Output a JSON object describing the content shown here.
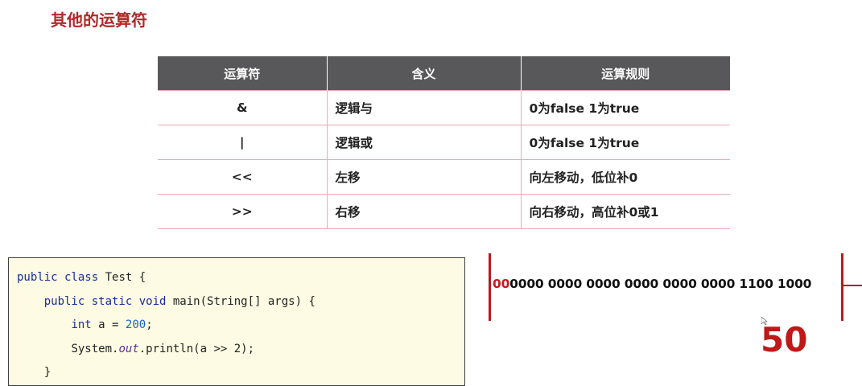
{
  "slide": {
    "title": "其他的运算符"
  },
  "table": {
    "headers": [
      "运算符",
      "含义",
      "运算规则"
    ],
    "rows": [
      {
        "op": "&",
        "meaning": "逻辑与",
        "rule": "0为false 1为true"
      },
      {
        "op": "|",
        "meaning": "逻辑或",
        "rule": "0为false 1为true"
      },
      {
        "op": "<<",
        "meaning": "左移",
        "rule": "向左移动，低位补0"
      },
      {
        "op": ">>",
        "meaning": "右移",
        "rule": "向右移动，高位补0或1"
      }
    ]
  },
  "code": {
    "line1_kw": "public class",
    "line1_rest": " Test {",
    "line2_indent": "    ",
    "line2_kw": "public static void",
    "line2_rest": " main(String[] args) {",
    "line3_indent": "        ",
    "line3_kw": "int",
    "line3_mid": " a = ",
    "line3_num": "200",
    "line3_end": ";",
    "line4_indent": "        ",
    "line4_a": "System.",
    "line4_it": "out",
    "line4_b": ".println(a >> 2);",
    "line5": "    }"
  },
  "binary": {
    "highlight": "00",
    "bits": "0000 0000 0000 0000 0000 0000 1100 1000"
  },
  "result": "50",
  "colors": {
    "title": "#b02a2a",
    "header_bg": "#58585a",
    "row_border": "#e8a9b6",
    "accent_red": "#c01818",
    "code_bg": "#fdfbe3"
  }
}
